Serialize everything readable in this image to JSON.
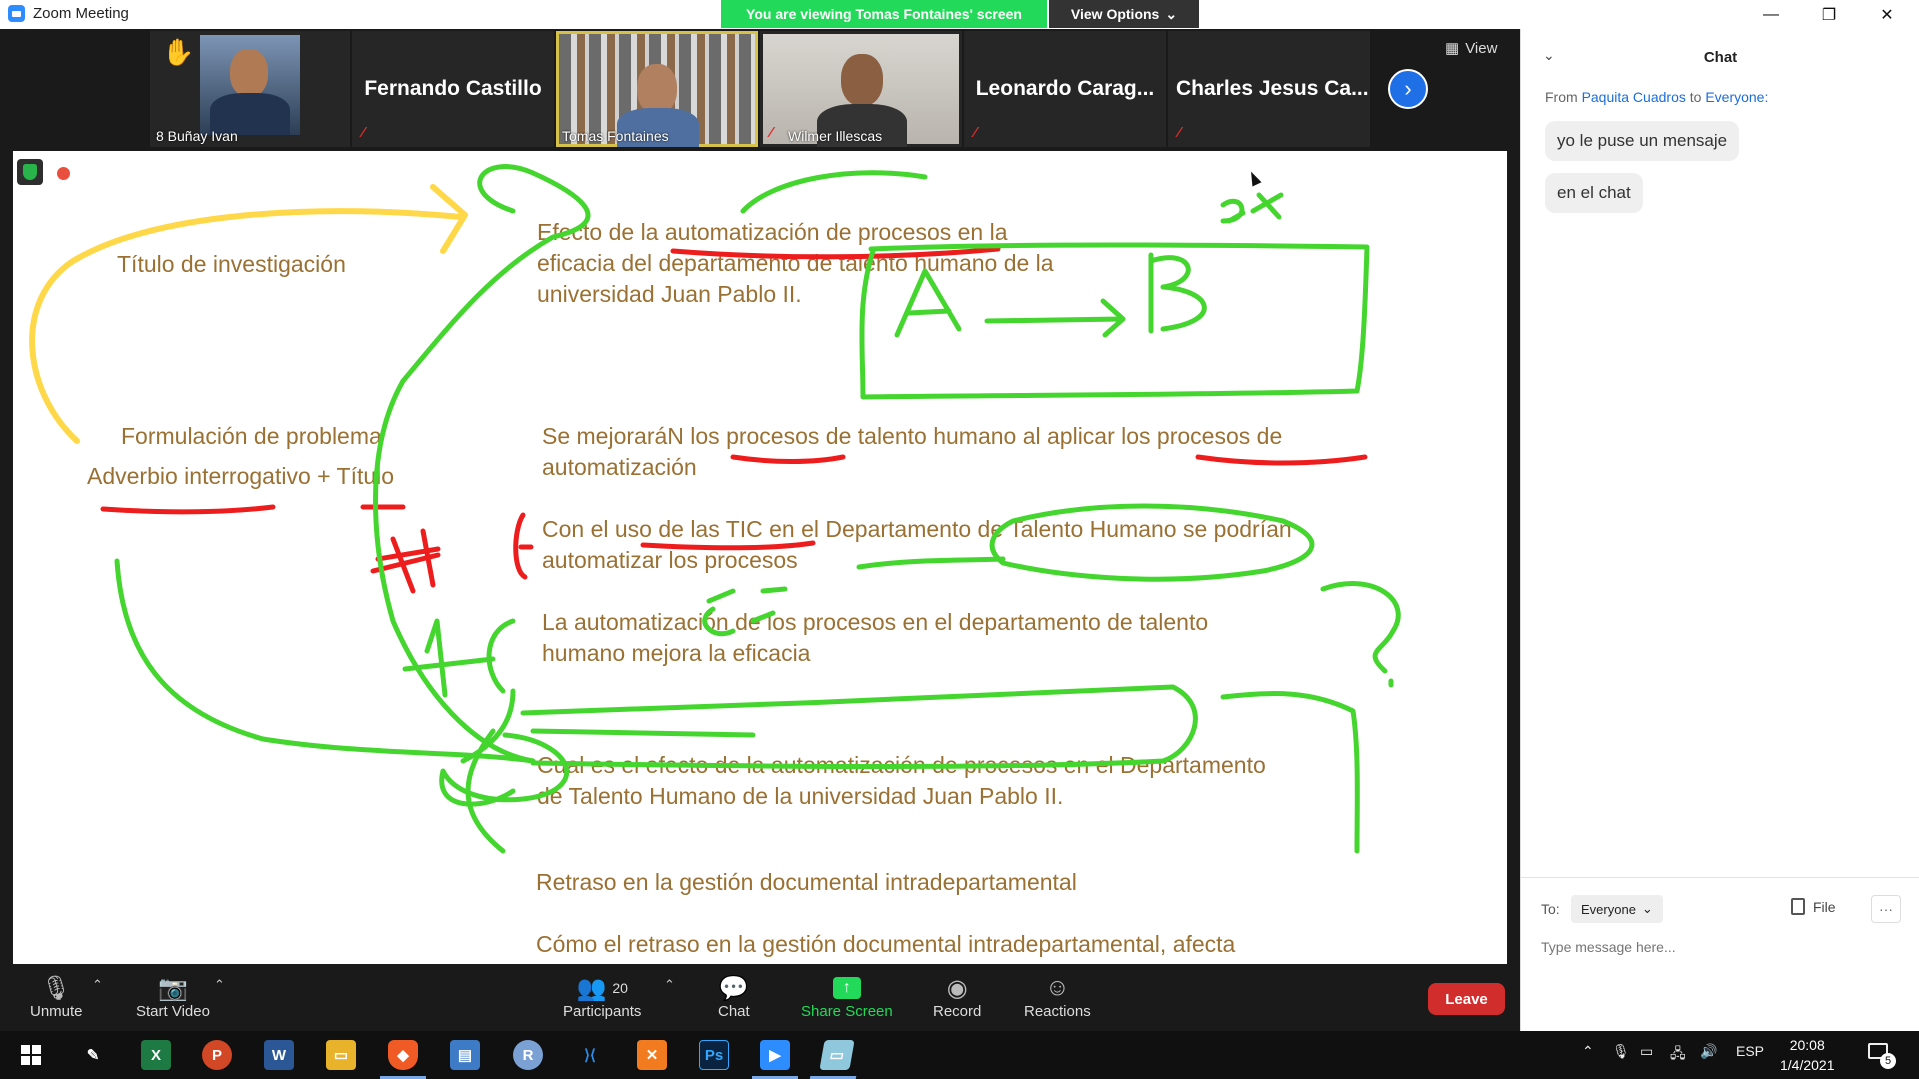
{
  "window": {
    "title": "Zoom Meeting"
  },
  "banner": {
    "viewing": "You are viewing Tomas Fontaines' screen",
    "view_options": "View Options"
  },
  "gallery": {
    "tiles": [
      {
        "name": "8 Buñay Ivan",
        "raised_hand": true
      },
      {
        "name": "Fernando Castillo",
        "muted": true
      },
      {
        "name": "Tomas Fontaines",
        "active_speaker": true
      },
      {
        "name": "Wilmer Illescas",
        "muted": true
      },
      {
        "name": "Leonardo  Carag...",
        "muted": true
      },
      {
        "name": "Charles  Jesus  Ca...",
        "muted": true
      }
    ],
    "view_label": "View"
  },
  "slide": {
    "lines": [
      "Título de investigación",
      "Efecto de la automatización de procesos en la",
      "eficacia del departamento de talento humano de la",
      "universidad Juan Pablo II.",
      "Formulación de problema",
      "Adverbio  interrogativo + Título",
      "Se mejoraráN los procesos  de talento humano al aplicar los procesos de",
      "automatización",
      "Con el uso de las TIC en el Departamento de Talento Humano se podrían",
      "automatizar los procesos",
      "La automatización de los procesos en el departamento de talento",
      "humano mejora la eficacia",
      "Cual es el efecto de la automatización de procesos en el Departamento",
      "de Talento Humano de la universidad Juan Pablo II.",
      "Retraso en la gestión documental intradepartamental",
      "Cómo el retraso en la gestión documental intradepartamental, afecta"
    ],
    "ink_colors": {
      "green": "#45d52f",
      "red": "#ee1d1d",
      "yellow": "#ffd84a"
    }
  },
  "toolbar": {
    "unmute": "Unmute",
    "start_video": "Start Video",
    "participants": "Participants",
    "participants_count": "20",
    "chat": "Chat",
    "share_screen": "Share Screen",
    "record": "Record",
    "reactions": "Reactions",
    "leave": "Leave"
  },
  "chat": {
    "title": "Chat",
    "from_prefix": "From",
    "from_name": "Paquita Cuadros",
    "to_word": "to",
    "to_name": "Everyone:",
    "messages": [
      "yo le puse un mensaje",
      "en el chat"
    ],
    "to_label": "To:",
    "recipient": "Everyone",
    "file_label": "File",
    "more_label": "···",
    "placeholder": "Type message here..."
  },
  "taskbar": {
    "language": "ESP",
    "time": "20:08",
    "date": "1/4/2021",
    "notification_count": "5",
    "apps": [
      "start-icon",
      "pen-icon",
      "excel-icon",
      "powerpoint-icon",
      "word-icon",
      "file-explorer-icon",
      "brave-icon",
      "news-icon",
      "r-icon",
      "vscode-icon",
      "xampp-icon",
      "photoshop-icon",
      "zoom-icon",
      "notes-icon"
    ]
  }
}
